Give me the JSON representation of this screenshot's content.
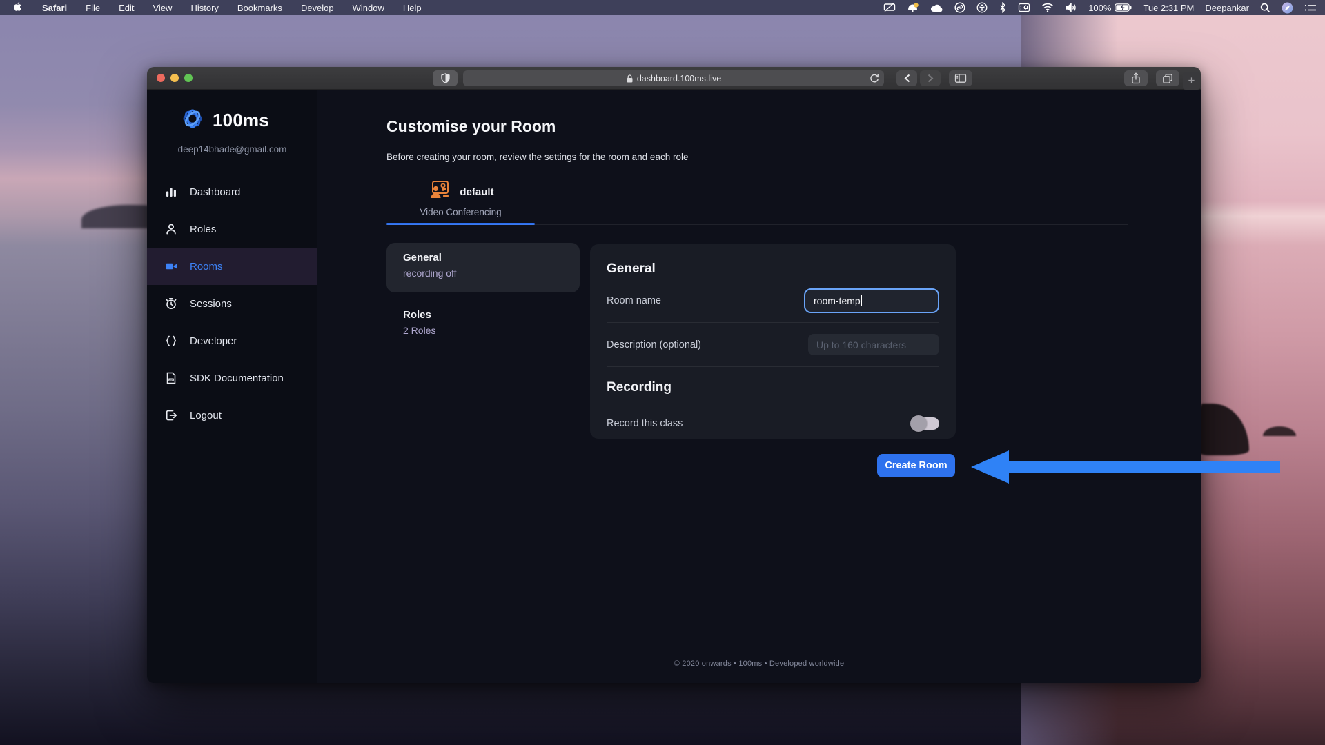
{
  "menu_bar": {
    "items": [
      "Safari",
      "File",
      "Edit",
      "View",
      "History",
      "Bookmarks",
      "Develop",
      "Window",
      "Help"
    ],
    "battery_label": "100%",
    "time": "Tue 2:31 PM",
    "user": "Deepankar"
  },
  "browser": {
    "url": "dashboard.100ms.live",
    "new_tab_label": "+"
  },
  "sidebar": {
    "brand": "100ms",
    "email": "deep14bhade@gmail.com",
    "items": [
      {
        "label": "Dashboard"
      },
      {
        "label": "Roles"
      },
      {
        "label": "Rooms",
        "active": true
      },
      {
        "label": "Sessions"
      },
      {
        "label": "Developer"
      },
      {
        "label": "SDK Documentation"
      },
      {
        "label": "Logout"
      }
    ]
  },
  "main": {
    "title": "Customise your Room",
    "subtitle": "Before creating your room, review the settings for the room and each role",
    "tab": {
      "name": "default",
      "type": "Video Conferencing"
    },
    "settings_nav": [
      {
        "title": "General",
        "subtitle": "recording off",
        "active": true
      },
      {
        "title": "Roles",
        "subtitle": "2 Roles",
        "active": false
      }
    ],
    "panel": {
      "general_heading": "General",
      "room_name_label": "Room name",
      "room_name_value": "room-temp",
      "description_label": "Description (optional)",
      "description_placeholder": "Up to 160 characters",
      "recording_heading": "Recording",
      "record_label": "Record this class",
      "record_enabled": false
    },
    "create_button_label": "Create Room",
    "footer": "© 2020 onwards • 100ms • Developed worldwide"
  },
  "colors": {
    "accent_blue": "#2e72ee",
    "active_nav_blue": "#3d82f6",
    "input_focus_border": "#6aa4f8",
    "tab_icon_orange": "#e8833a",
    "annotation_arrow": "#2f82f6",
    "toggle_track": "#cfc9d4",
    "toggle_knob": "#a3a0aa"
  }
}
